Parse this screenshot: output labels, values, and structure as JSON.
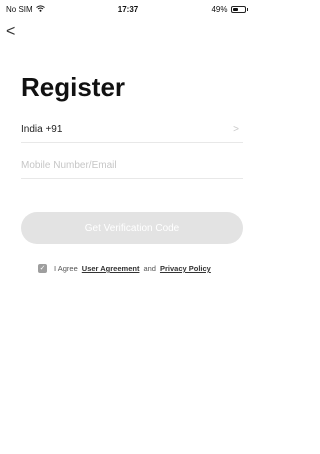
{
  "status_bar": {
    "carrier": "No SIM",
    "wifi_icon": "wifi-icon",
    "time": "17:37",
    "battery_text": "49%",
    "battery_level": 0.49
  },
  "nav": {
    "back_icon": "chevron-left-icon",
    "back_glyph": "<"
  },
  "title": "Register",
  "country": {
    "label": "India +91",
    "chevron_glyph": ">"
  },
  "mobile": {
    "placeholder": "Mobile Number/Email",
    "value": ""
  },
  "verify_button": {
    "label": "Get Verification Code",
    "disabled": true
  },
  "agreement": {
    "checked": true,
    "check_glyph": "✓",
    "prefix": "I Agree",
    "user_agreement": "User Agreement",
    "and": "and",
    "privacy_policy": "Privacy Policy"
  },
  "colors": {
    "button_bg": "#e3e3e3",
    "placeholder": "#c6c6c6",
    "checkbox": "#9e9e9e"
  }
}
